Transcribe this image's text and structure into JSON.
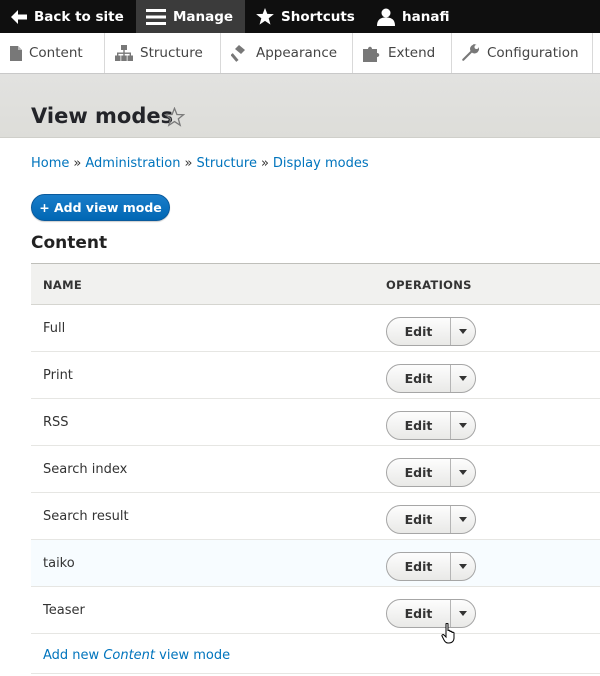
{
  "toolbar": {
    "back_label": "Back to site",
    "manage_label": "Manage",
    "shortcuts_label": "Shortcuts",
    "user_label": "hanafi"
  },
  "admin_menu": {
    "content": "Content",
    "structure": "Structure",
    "appearance": "Appearance",
    "extend": "Extend",
    "configuration": "Configuration"
  },
  "page": {
    "title": "View modes"
  },
  "breadcrumb": {
    "home": "Home",
    "administration": "Administration",
    "structure": "Structure",
    "display_modes": "Display modes",
    "separator": "»"
  },
  "add_button_label": "+ Add view mode",
  "section": {
    "title": "Content",
    "columns": {
      "name": "NAME",
      "operations": "OPERATIONS"
    },
    "rows": [
      {
        "name": "Full",
        "op": "Edit"
      },
      {
        "name": "Print",
        "op": "Edit"
      },
      {
        "name": "RSS",
        "op": "Edit"
      },
      {
        "name": "Search index",
        "op": "Edit"
      },
      {
        "name": "Search result",
        "op": "Edit"
      },
      {
        "name": "taiko",
        "op": "Edit"
      },
      {
        "name": "Teaser",
        "op": "Edit"
      }
    ],
    "add_new": {
      "prefix": "Add new",
      "entity": "Content",
      "suffix": "view mode"
    }
  },
  "icons": {
    "back": "arrow-left-icon",
    "manage": "hamburger-menu-icon",
    "shortcuts": "star-icon",
    "user": "user-icon",
    "content": "document-icon",
    "structure": "sitemap-icon",
    "appearance": "paint-roller-icon",
    "extend": "puzzle-icon",
    "configuration": "wrench-icon",
    "title_star": "star-outline-icon",
    "dropdown": "caret-down-icon"
  },
  "colors": {
    "link": "#0074bd",
    "primary_button": "#0071b8",
    "toolbar": "#0f0f0f"
  }
}
